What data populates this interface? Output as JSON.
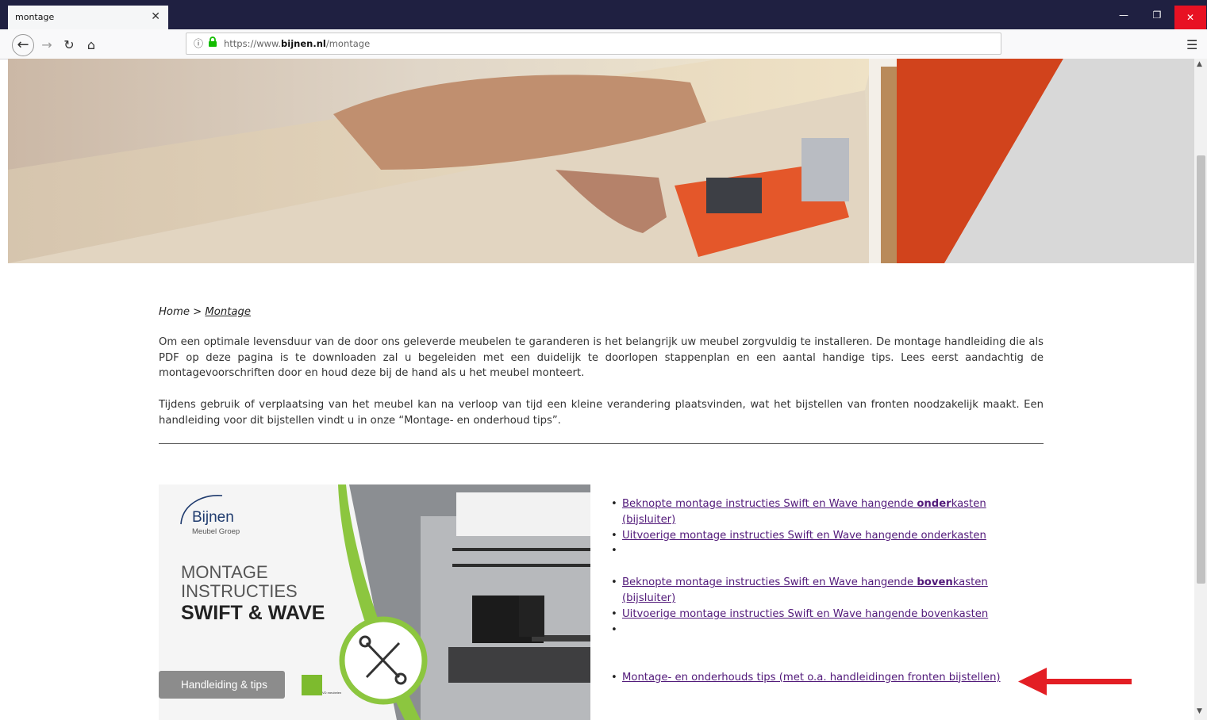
{
  "browser": {
    "tab_title": "montage",
    "url_prefix": "https://www.",
    "url_domain": "bijnen.nl",
    "url_path": "/montage"
  },
  "breadcrumb": {
    "home": "Home",
    "separator": ">",
    "current": "Montage"
  },
  "intro": {
    "p1": "Om een optimale levensduur van de door ons geleverde meubelen te garanderen is het belangrijk uw meubel zorgvuldig te installeren. De montage handleiding die als PDF op deze pagina is te downloaden zal u begeleiden met een duidelijk te doorlopen stappenplan en een aantal handige tips. Lees eerst aandachtig de montagevoorschriften door en houd deze bij de hand als u het meubel monteert.",
    "p2": "Tijdens gebruik of verplaatsing van het meubel kan na verloop van tijd een kleine verandering plaatsvinden, wat het bijstellen van fronten noodzakelijk maakt. Een handleiding voor dit bijstellen vindt u in onze “Montage- en onderhoud tips”."
  },
  "promo": {
    "logo_name": "Bijnen",
    "logo_sub": "Meubel Groep",
    "line1": "MONTAGE",
    "line2": "INSTRUCTIES",
    "line3": "SWIFT & WAVE",
    "badge": "Handleiding & tips",
    "vd_logo": "VD meubelen"
  },
  "links": {
    "l1_pre": "Beknopte montage instructies Swift en Wave hangende ",
    "l1_bold": "onder",
    "l1_post": "kasten (bijsluiter)",
    "l2": "Uitvoerige montage instructies Swift en Wave hangende onderkasten",
    "l3_pre": "Beknopte montage instructies Swift en Wave hangende ",
    "l3_bold": "boven",
    "l3_post": "kasten (bijsluiter)",
    "l4": "Uitvoerige montage instructies Swift en Wave hangende bovenkasten",
    "l5": "Montage- en onderhouds tips (met o.a. handleidingen fronten bijstellen)"
  },
  "icons": {
    "back": "back-arrow-icon",
    "forward": "forward-arrow-icon",
    "reload": "reload-icon",
    "home": "home-icon",
    "info": "info-icon",
    "lock": "lock-icon",
    "menu": "hamburger-menu-icon",
    "annotation": "red-arrow-icon"
  },
  "colors": {
    "titlebar": "#1f2041",
    "link": "#521a7a",
    "accent_green": "#8cc63f",
    "arrow_red": "#e31e24",
    "close_red": "#e81123"
  }
}
